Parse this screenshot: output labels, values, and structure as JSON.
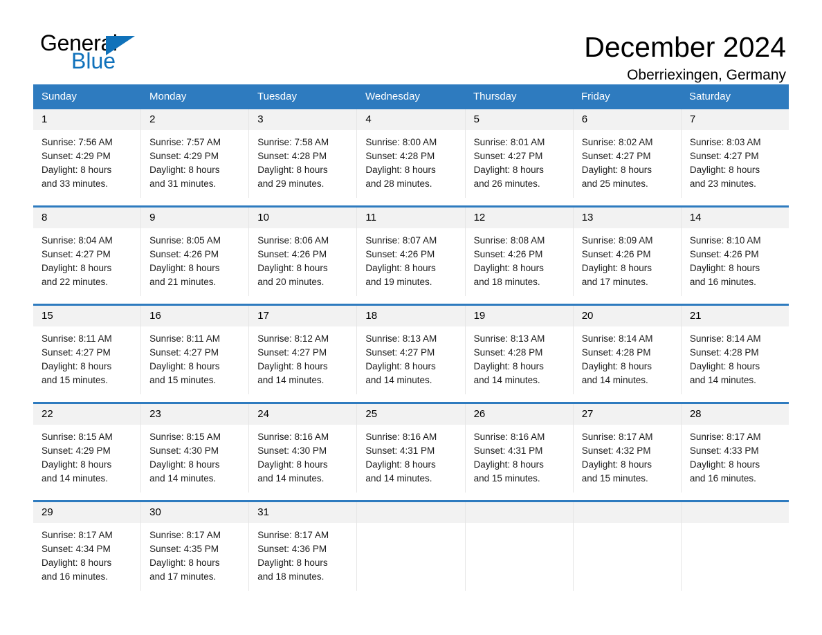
{
  "brand": {
    "name_dark": "General",
    "name_light": "Blue",
    "accent_color": "#1072BA"
  },
  "header": {
    "title": "December 2024",
    "subtitle": "Oberriexingen, Germany"
  },
  "calendar": {
    "header_bg": "#2E7BBF",
    "header_text_color": "#FFFFFF",
    "day_number_bg": "#F2F2F2",
    "weekdays": [
      "Sunday",
      "Monday",
      "Tuesday",
      "Wednesday",
      "Thursday",
      "Friday",
      "Saturday"
    ],
    "weeks": [
      [
        {
          "day": "1",
          "sunrise": "Sunrise: 7:56 AM",
          "sunset": "Sunset: 4:29 PM",
          "daylight_line1": "Daylight: 8 hours",
          "daylight_line2": "and 33 minutes."
        },
        {
          "day": "2",
          "sunrise": "Sunrise: 7:57 AM",
          "sunset": "Sunset: 4:29 PM",
          "daylight_line1": "Daylight: 8 hours",
          "daylight_line2": "and 31 minutes."
        },
        {
          "day": "3",
          "sunrise": "Sunrise: 7:58 AM",
          "sunset": "Sunset: 4:28 PM",
          "daylight_line1": "Daylight: 8 hours",
          "daylight_line2": "and 29 minutes."
        },
        {
          "day": "4",
          "sunrise": "Sunrise: 8:00 AM",
          "sunset": "Sunset: 4:28 PM",
          "daylight_line1": "Daylight: 8 hours",
          "daylight_line2": "and 28 minutes."
        },
        {
          "day": "5",
          "sunrise": "Sunrise: 8:01 AM",
          "sunset": "Sunset: 4:27 PM",
          "daylight_line1": "Daylight: 8 hours",
          "daylight_line2": "and 26 minutes."
        },
        {
          "day": "6",
          "sunrise": "Sunrise: 8:02 AM",
          "sunset": "Sunset: 4:27 PM",
          "daylight_line1": "Daylight: 8 hours",
          "daylight_line2": "and 25 minutes."
        },
        {
          "day": "7",
          "sunrise": "Sunrise: 8:03 AM",
          "sunset": "Sunset: 4:27 PM",
          "daylight_line1": "Daylight: 8 hours",
          "daylight_line2": "and 23 minutes."
        }
      ],
      [
        {
          "day": "8",
          "sunrise": "Sunrise: 8:04 AM",
          "sunset": "Sunset: 4:27 PM",
          "daylight_line1": "Daylight: 8 hours",
          "daylight_line2": "and 22 minutes."
        },
        {
          "day": "9",
          "sunrise": "Sunrise: 8:05 AM",
          "sunset": "Sunset: 4:26 PM",
          "daylight_line1": "Daylight: 8 hours",
          "daylight_line2": "and 21 minutes."
        },
        {
          "day": "10",
          "sunrise": "Sunrise: 8:06 AM",
          "sunset": "Sunset: 4:26 PM",
          "daylight_line1": "Daylight: 8 hours",
          "daylight_line2": "and 20 minutes."
        },
        {
          "day": "11",
          "sunrise": "Sunrise: 8:07 AM",
          "sunset": "Sunset: 4:26 PM",
          "daylight_line1": "Daylight: 8 hours",
          "daylight_line2": "and 19 minutes."
        },
        {
          "day": "12",
          "sunrise": "Sunrise: 8:08 AM",
          "sunset": "Sunset: 4:26 PM",
          "daylight_line1": "Daylight: 8 hours",
          "daylight_line2": "and 18 minutes."
        },
        {
          "day": "13",
          "sunrise": "Sunrise: 8:09 AM",
          "sunset": "Sunset: 4:26 PM",
          "daylight_line1": "Daylight: 8 hours",
          "daylight_line2": "and 17 minutes."
        },
        {
          "day": "14",
          "sunrise": "Sunrise: 8:10 AM",
          "sunset": "Sunset: 4:26 PM",
          "daylight_line1": "Daylight: 8 hours",
          "daylight_line2": "and 16 minutes."
        }
      ],
      [
        {
          "day": "15",
          "sunrise": "Sunrise: 8:11 AM",
          "sunset": "Sunset: 4:27 PM",
          "daylight_line1": "Daylight: 8 hours",
          "daylight_line2": "and 15 minutes."
        },
        {
          "day": "16",
          "sunrise": "Sunrise: 8:11 AM",
          "sunset": "Sunset: 4:27 PM",
          "daylight_line1": "Daylight: 8 hours",
          "daylight_line2": "and 15 minutes."
        },
        {
          "day": "17",
          "sunrise": "Sunrise: 8:12 AM",
          "sunset": "Sunset: 4:27 PM",
          "daylight_line1": "Daylight: 8 hours",
          "daylight_line2": "and 14 minutes."
        },
        {
          "day": "18",
          "sunrise": "Sunrise: 8:13 AM",
          "sunset": "Sunset: 4:27 PM",
          "daylight_line1": "Daylight: 8 hours",
          "daylight_line2": "and 14 minutes."
        },
        {
          "day": "19",
          "sunrise": "Sunrise: 8:13 AM",
          "sunset": "Sunset: 4:28 PM",
          "daylight_line1": "Daylight: 8 hours",
          "daylight_line2": "and 14 minutes."
        },
        {
          "day": "20",
          "sunrise": "Sunrise: 8:14 AM",
          "sunset": "Sunset: 4:28 PM",
          "daylight_line1": "Daylight: 8 hours",
          "daylight_line2": "and 14 minutes."
        },
        {
          "day": "21",
          "sunrise": "Sunrise: 8:14 AM",
          "sunset": "Sunset: 4:28 PM",
          "daylight_line1": "Daylight: 8 hours",
          "daylight_line2": "and 14 minutes."
        }
      ],
      [
        {
          "day": "22",
          "sunrise": "Sunrise: 8:15 AM",
          "sunset": "Sunset: 4:29 PM",
          "daylight_line1": "Daylight: 8 hours",
          "daylight_line2": "and 14 minutes."
        },
        {
          "day": "23",
          "sunrise": "Sunrise: 8:15 AM",
          "sunset": "Sunset: 4:30 PM",
          "daylight_line1": "Daylight: 8 hours",
          "daylight_line2": "and 14 minutes."
        },
        {
          "day": "24",
          "sunrise": "Sunrise: 8:16 AM",
          "sunset": "Sunset: 4:30 PM",
          "daylight_line1": "Daylight: 8 hours",
          "daylight_line2": "and 14 minutes."
        },
        {
          "day": "25",
          "sunrise": "Sunrise: 8:16 AM",
          "sunset": "Sunset: 4:31 PM",
          "daylight_line1": "Daylight: 8 hours",
          "daylight_line2": "and 14 minutes."
        },
        {
          "day": "26",
          "sunrise": "Sunrise: 8:16 AM",
          "sunset": "Sunset: 4:31 PM",
          "daylight_line1": "Daylight: 8 hours",
          "daylight_line2": "and 15 minutes."
        },
        {
          "day": "27",
          "sunrise": "Sunrise: 8:17 AM",
          "sunset": "Sunset: 4:32 PM",
          "daylight_line1": "Daylight: 8 hours",
          "daylight_line2": "and 15 minutes."
        },
        {
          "day": "28",
          "sunrise": "Sunrise: 8:17 AM",
          "sunset": "Sunset: 4:33 PM",
          "daylight_line1": "Daylight: 8 hours",
          "daylight_line2": "and 16 minutes."
        }
      ],
      [
        {
          "day": "29",
          "sunrise": "Sunrise: 8:17 AM",
          "sunset": "Sunset: 4:34 PM",
          "daylight_line1": "Daylight: 8 hours",
          "daylight_line2": "and 16 minutes."
        },
        {
          "day": "30",
          "sunrise": "Sunrise: 8:17 AM",
          "sunset": "Sunset: 4:35 PM",
          "daylight_line1": "Daylight: 8 hours",
          "daylight_line2": "and 17 minutes."
        },
        {
          "day": "31",
          "sunrise": "Sunrise: 8:17 AM",
          "sunset": "Sunset: 4:36 PM",
          "daylight_line1": "Daylight: 8 hours",
          "daylight_line2": "and 18 minutes."
        },
        {
          "day": "",
          "sunrise": "",
          "sunset": "",
          "daylight_line1": "",
          "daylight_line2": ""
        },
        {
          "day": "",
          "sunrise": "",
          "sunset": "",
          "daylight_line1": "",
          "daylight_line2": ""
        },
        {
          "day": "",
          "sunrise": "",
          "sunset": "",
          "daylight_line1": "",
          "daylight_line2": ""
        },
        {
          "day": "",
          "sunrise": "",
          "sunset": "",
          "daylight_line1": "",
          "daylight_line2": ""
        }
      ]
    ]
  }
}
